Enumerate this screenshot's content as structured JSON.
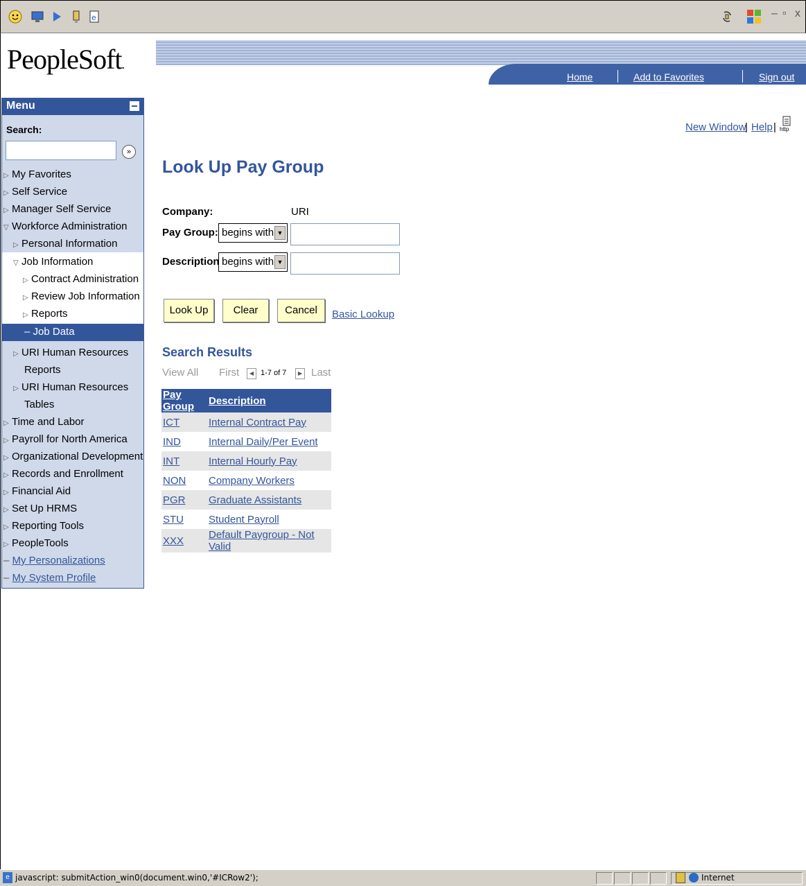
{
  "header": {
    "logo": "PeopleSoft",
    "logo_mark": ".",
    "links": {
      "home": "Home",
      "favorites": "Add to Favorites",
      "signout": "Sign out"
    }
  },
  "menu": {
    "title": "Menu",
    "search_label": "Search:",
    "go_glyph": "»",
    "items": {
      "my_favorites": "My Favorites",
      "self_service": "Self Service",
      "manager_self_service": "Manager Self Service",
      "workforce_admin": "Workforce Administration",
      "personal_info": "Personal Information",
      "job_info": "Job Information",
      "contract_admin": "Contract Administration",
      "review_job": "Review Job Information",
      "reports": "Reports",
      "job_data": "Job Data",
      "uri_hr_reports_1": "URI Human Resources",
      "uri_hr_reports_2": "Reports",
      "uri_hr_tables_1": "URI Human Resources",
      "uri_hr_tables_2": "Tables",
      "time_labor": "Time and Labor",
      "payroll_na": "Payroll for North America",
      "org_dev": "Organizational Development",
      "records_enroll": "Records and Enrollment",
      "financial_aid": "Financial Aid",
      "setup_hrms": "Set Up HRMS",
      "reporting_tools": "Reporting Tools",
      "peopletools": "PeopleTools",
      "my_personalizations": "My Personalizations",
      "my_system_profile": "My System Profile"
    }
  },
  "toplinks": {
    "new_window": "New Window",
    "help": "Help",
    "sep": "|",
    "http": "http"
  },
  "page": {
    "title": "Look Up Pay Group",
    "company_label": "Company:",
    "company_value": "URI",
    "paygroup_label": "Pay Group:",
    "paygroup_operator": "begins with",
    "description_label": "Description:",
    "description_operator": "begins with",
    "buttons": {
      "lookup": "Look Up",
      "clear": "Clear",
      "cancel": "Cancel"
    },
    "basic_lookup": "Basic Lookup"
  },
  "results": {
    "title": "Search Results",
    "view_all": "View All",
    "first": "First",
    "range": "1-7 of 7",
    "last": "Last",
    "columns": [
      "Pay Group",
      "Description"
    ],
    "rows": [
      [
        "ICT",
        "Internal Contract Pay"
      ],
      [
        "IND",
        "Internal Daily/Per Event"
      ],
      [
        "INT",
        "Internal Hourly Pay"
      ],
      [
        "NON",
        "Company Workers"
      ],
      [
        "PGR",
        "Graduate Assistants"
      ],
      [
        "STU",
        "Student Payroll"
      ],
      [
        "XXX",
        "Default Paygroup - Not Valid"
      ]
    ]
  },
  "statusbar": {
    "text": "javascript: submitAction_win0(document.win0,'#ICRow2');",
    "zone": "Internet"
  },
  "colors": {
    "accent": "#33569b",
    "button_bg": "#ffffcc",
    "menu_bg": "#d0d9ea"
  },
  "icons": [
    "smiley-icon",
    "monitor-icon",
    "arrow-icon",
    "usb-icon",
    "ie-page-icon",
    "sync-icon",
    "windows-logo-icon",
    "lock-icon",
    "globe-icon"
  ]
}
